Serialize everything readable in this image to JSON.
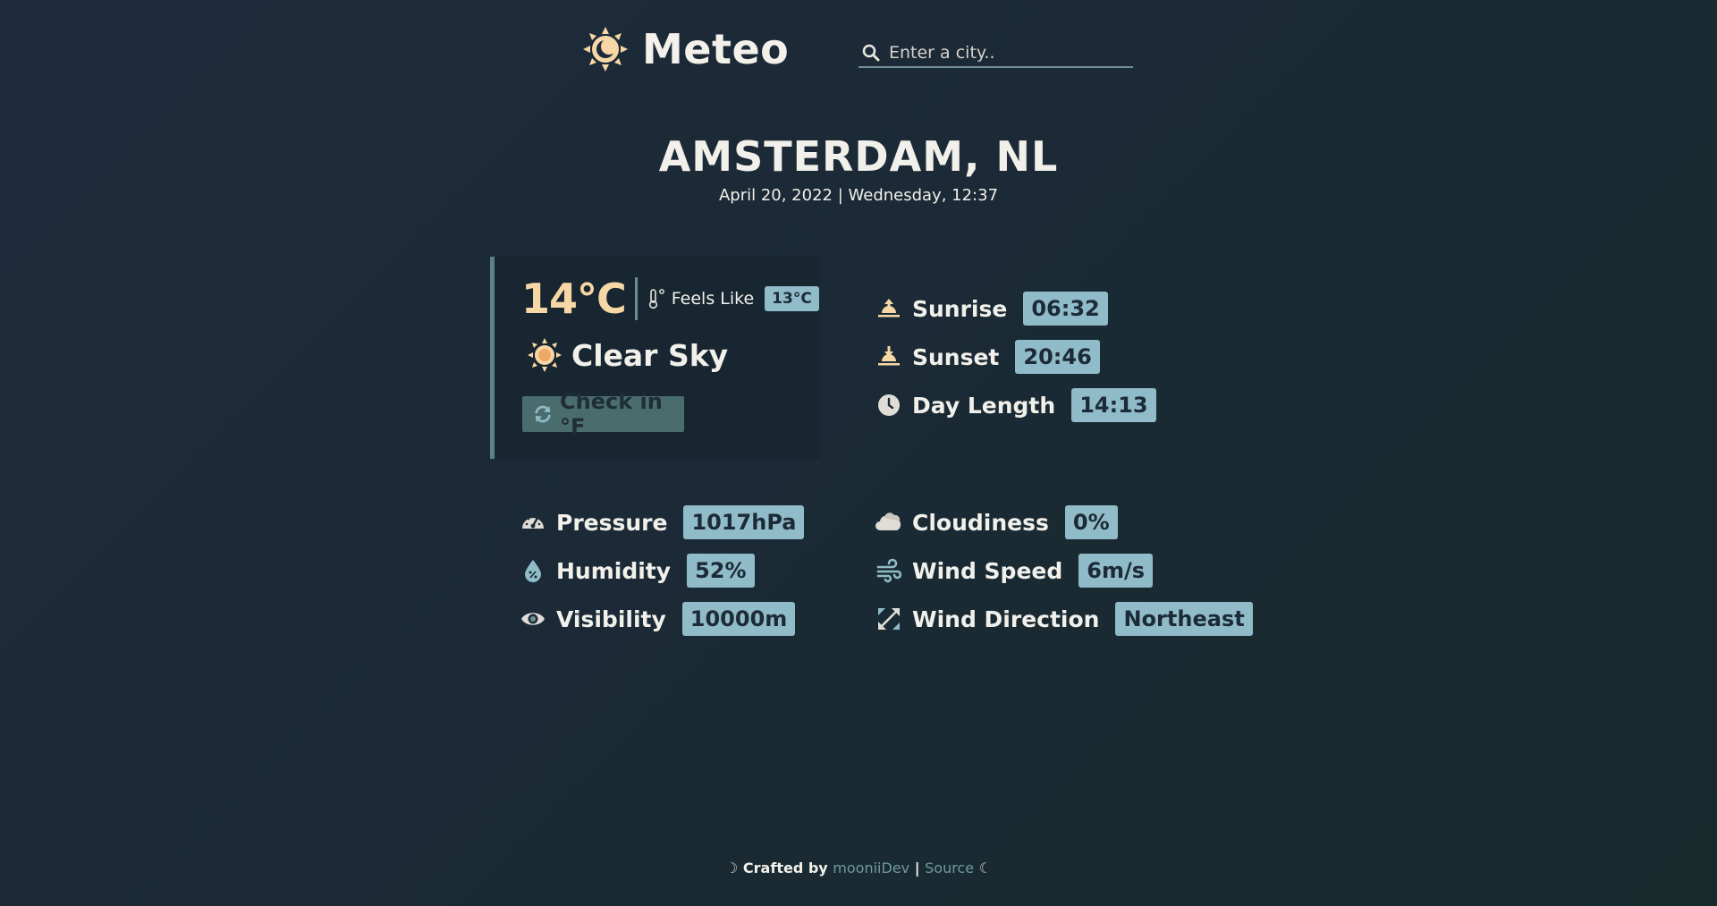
{
  "header": {
    "title": "Meteo",
    "logo_icon": "sun-moon-icon",
    "search": {
      "placeholder": "Enter a city..",
      "value": "",
      "icon": "search-icon"
    }
  },
  "location": {
    "city": "AMSTERDAM, NL",
    "datetime": "April 20, 2022 | Wednesday, 12:37"
  },
  "current": {
    "temperature": "14°C",
    "feels_like_label": "Feels Like",
    "feels_like_value": "13°C",
    "condition": "Clear Sky",
    "toggle_label": "Check in °F"
  },
  "sun": [
    {
      "icon": "sunrise-icon",
      "label": "Sunrise",
      "value": "06:32"
    },
    {
      "icon": "sunset-icon",
      "label": "Sunset",
      "value": "20:46"
    },
    {
      "icon": "clock-icon",
      "label": "Day Length",
      "value": "14:13"
    }
  ],
  "details_left": [
    {
      "icon": "gauge-icon",
      "label": "Pressure",
      "value": "1017hPa"
    },
    {
      "icon": "droplet-icon",
      "label": "Humidity",
      "value": "52%"
    },
    {
      "icon": "eye-icon",
      "label": "Visibility",
      "value": "10000m"
    }
  ],
  "details_right": [
    {
      "icon": "cloud-icon",
      "label": "Cloudiness",
      "value": "0%"
    },
    {
      "icon": "wind-icon",
      "label": "Wind Speed",
      "value": "6m/s"
    },
    {
      "icon": "compass-arrows-icon",
      "label": "Wind Direction",
      "value": "Northeast"
    }
  ],
  "footer": {
    "moon_left": "☽",
    "crafted_by": "Crafted by",
    "author": "mooniiDev",
    "separator": "|",
    "source": "Source",
    "moon_right": "☾"
  },
  "colors": {
    "accent_temp": "#f7d7a5",
    "badge_bg": "#8fbcc8",
    "badge_text": "#1d2a37",
    "card_border": "#5d8189",
    "button_bg": "#4b6c6c",
    "link": "#6e9a98"
  }
}
